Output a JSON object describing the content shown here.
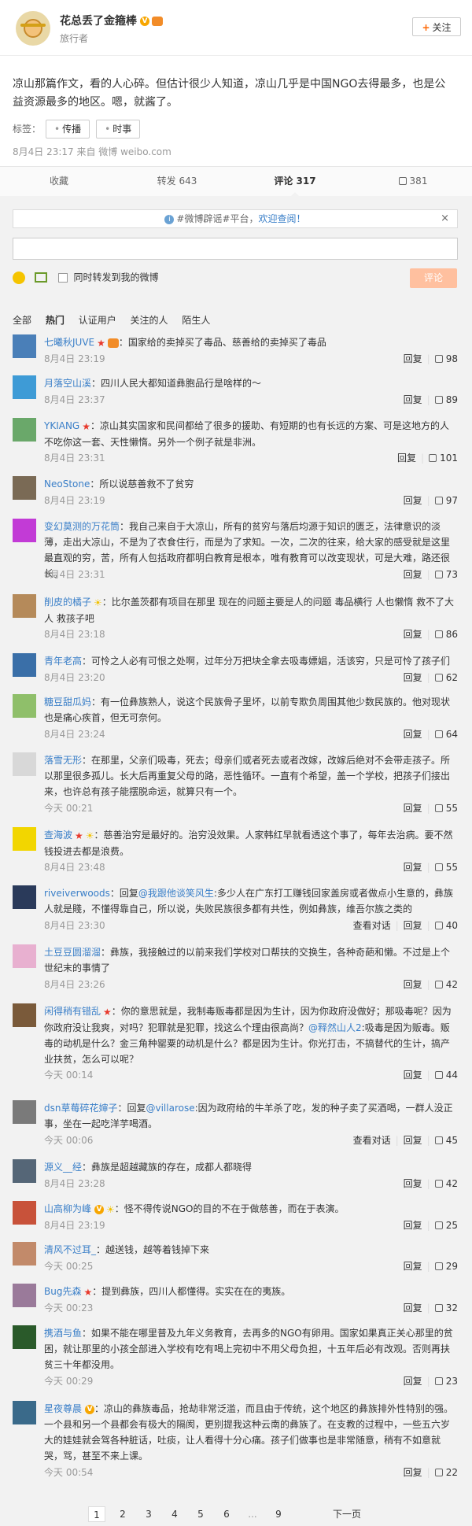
{
  "header": {
    "name": "花总丢了金箍棒",
    "subtitle": "旅行者",
    "follow_label": "关注"
  },
  "post": {
    "text": "凉山那篇作文，看的人心碎。但估计很少人知道，凉山几乎是中国NGO去得最多，也是公益资源最多的地区。嗯，就酱了。",
    "tags_label": "标签：",
    "tags": [
      "传播",
      "时事"
    ],
    "meta": "8月4日 23:17 来自 微博 weibo.com"
  },
  "actions": {
    "collect": "收藏",
    "repost": "转发 643",
    "comment": "评论 317",
    "like": "381"
  },
  "comment_box": {
    "notice_hash": "#微博辟谣#平台，",
    "notice_link": "欢迎查阅！",
    "close": "×",
    "repost_label": "同时转发到我的微博",
    "submit": "评论"
  },
  "filters": [
    "全部",
    "热门",
    "认证用户",
    "关注的人",
    "陌生人"
  ],
  "comments": [
    {
      "name": "七曦秋JUVE",
      "text": "：国家给的卖掉买了毒品、慈善给的卖掉买了毒品",
      "time": "8月4日 23:19",
      "reply": "回复",
      "likes": "98",
      "extra": ""
    },
    {
      "name": "月落空山溪",
      "text": "：四川人民大都知道彝胞品行是啥样的～",
      "time": "8月4日 23:37",
      "reply": "回复",
      "likes": "89",
      "extra": ""
    },
    {
      "name": "YKIANG",
      "text": "：凉山其实国家和民间都给了很多的援助、有短期的也有长远的方案、可是这地方的人不吃你这一套、天性懒惰。另外一个例子就是非洲。",
      "time": "8月4日 23:31",
      "reply": "回复",
      "likes": "101",
      "extra": ""
    },
    {
      "name": "NeoStone",
      "text": "：所以说慈善救不了贫穷",
      "time": "8月4日 23:19",
      "reply": "回复",
      "likes": "97",
      "extra": ""
    },
    {
      "name": "变幻莫测的万花筒",
      "text": "：我自己来自于大凉山，所有的贫穷与落后均源于知识的匮乏，法律意识的淡薄，走出大凉山，不是为了衣食住行，而是为了求知。一次，二次的往来，给大家的感受就是这里最直观的穷，苦，所有人包括政府都明白教育是根本，唯有教育可以改变现状，可是大难，路还很长。",
      "time": "8月4日 23:31",
      "reply": "回复",
      "likes": "73",
      "extra": ""
    },
    {
      "name": "削皮的橘子",
      "text": "：比尔盖茨都有项目在那里 现在的问题主要是人的问题 毒品横行 人也懒惰 救不了大人 救孩子吧",
      "time": "8月4日 23:18",
      "reply": "回复",
      "likes": "86",
      "extra": ""
    },
    {
      "name": "青年老高",
      "text": "：可怜之人必有可恨之处啊，过年分万把块全拿去吸毒嫖娼，活该穷，只是可怜了孩子们",
      "time": "8月4日 23:20",
      "reply": "回复",
      "likes": "62",
      "extra": ""
    },
    {
      "name": "糖豆甜瓜妈",
      "text": "：有一位彝族熟人，说这个民族骨子里坏，以前专欺负周围其他少数民族的。他对现状也是痛心疾首，但无可奈何。",
      "time": "8月4日 23:24",
      "reply": "回复",
      "likes": "64",
      "extra": ""
    },
    {
      "name": "落雪无形",
      "text": "：在那里，父亲们吸毒，死去；母亲们或者死去或者改嫁，改嫁后绝对不会带走孩子。所以那里很多孤儿。长大后再重复父母的路，恶性循环。一直有个希望，盖一个学校，把孩子们接出来，也许总有孩子能摆脱命运，就算只有一个。",
      "time": "今天 00:21",
      "reply": "回复",
      "likes": "55",
      "extra": ""
    },
    {
      "name": "查海波",
      "text": "：慈善治穷是最好的。治穷没效果。人家韩红早就看透这个事了，每年去治病。要不然钱投进去都是浪费。",
      "time": "8月4日 23:48",
      "reply": "回复",
      "likes": "55",
      "extra": ""
    },
    {
      "name": "riveiverwoods",
      "text": "：回复",
      "mention": "@我跟他谈笑风生",
      "text2": ":多少人在广东打工赚钱回家盖房或者做点小生意的，彝族人就是賤，不懂得靠自己，所以说，失败民族很多都有共性，例如彝族，维吾尔族之类的",
      "time": "8月4日 23:30",
      "reply": "回复",
      "likes": "40",
      "extra": "查看对话"
    },
    {
      "name": "土豆豆圆溜溜",
      "text": "：彝族，我接触过的以前来我们学校对口帮扶的交换生，各种奇葩和懒。不过是上个世纪末的事情了",
      "time": "8月4日 23:26",
      "reply": "回复",
      "likes": "42",
      "extra": ""
    },
    {
      "name": "闲得稍有错乱",
      "text": "：你的意思就是，我制毒贩毒都是因为生计，因为你政府没做好；那吸毒呢？因为你政府没让我爽，对吗？犯罪就是犯罪，找这么个理由很高尚？",
      "mention": "@释然山人2",
      "text2": ":吸毒是因为贩毒。贩毒的动机是什么？金三角种罂粟的动机是什么？都是因为生计。你光打击，不搞替代的生计，搞产业扶贫，怎么可以呢？",
      "time": "今天 00:14",
      "reply": "回复",
      "likes": "44",
      "extra": ""
    },
    {
      "name": "dsn草莓碎花婶子",
      "text": "：回复",
      "mention": "@villarose",
      "text2": ":因为政府给的牛羊杀了吃，发的种子卖了买酒喝，一群人没正事，坐在一起吃洋芋喝酒。",
      "time": "今天 00:06",
      "reply": "回复",
      "likes": "45",
      "extra": "查看对话"
    },
    {
      "name": "源义__经",
      "text": "：彝族是超越藏族的存在，成都人都晓得",
      "time": "8月4日 23:28",
      "reply": "回复",
      "likes": "42",
      "extra": ""
    },
    {
      "name": "山高柳为峰",
      "text": "：怪不得传说NGO的目的不在于做慈善，而在于表演。",
      "time": "8月4日 23:19",
      "reply": "回复",
      "likes": "25",
      "extra": ""
    },
    {
      "name": "清风不过耳_",
      "text": "：越送钱，越等着钱掉下来",
      "time": "今天 00:25",
      "reply": "回复",
      "likes": "29",
      "extra": ""
    },
    {
      "name": "Bug先森",
      "text": "：提到彝族，四川人都懂得。实实在在的夷族。",
      "time": "今天 00:23",
      "reply": "回复",
      "likes": "32",
      "extra": ""
    },
    {
      "name": "携酒与鱼",
      "text": "：如果不能在哪里普及九年义务教育，去再多的NGO有卵用。国家如果真正关心那里的贫困，就让那里的小孩全部进入学校有吃有喝上完初中不用父母负担，十五年后必有改观。否则再扶贫三十年都没用。",
      "time": "今天 00:29",
      "reply": "回复",
      "likes": "23",
      "extra": ""
    },
    {
      "name": "星夜尊晨",
      "text": "：凉山的彝族毒品，抢劫非常泛滥，而且由于传统，这个地区的彝族排外性特别的强。一个县和另一个县都会有极大的隔阂，更别提我这种云南的彝族了。在支教的过程中，一些五六岁大的娃娃就会驾各种脏话，吐痰，让人看得十分心痛。孩子们做事也是非常随意，稍有不如意就哭，骂，甚至不来上课。",
      "time": "今天 00:54",
      "reply": "回复",
      "likes": "22",
      "extra": ""
    }
  ],
  "pagination": {
    "pages": [
      "1",
      "2",
      "3",
      "4",
      "5",
      "6",
      "...",
      "9"
    ],
    "next": "下一页"
  },
  "colors": {
    "link": "#3a7fc8",
    "accent": "#ff8140",
    "panel": "#f2f2f2"
  }
}
